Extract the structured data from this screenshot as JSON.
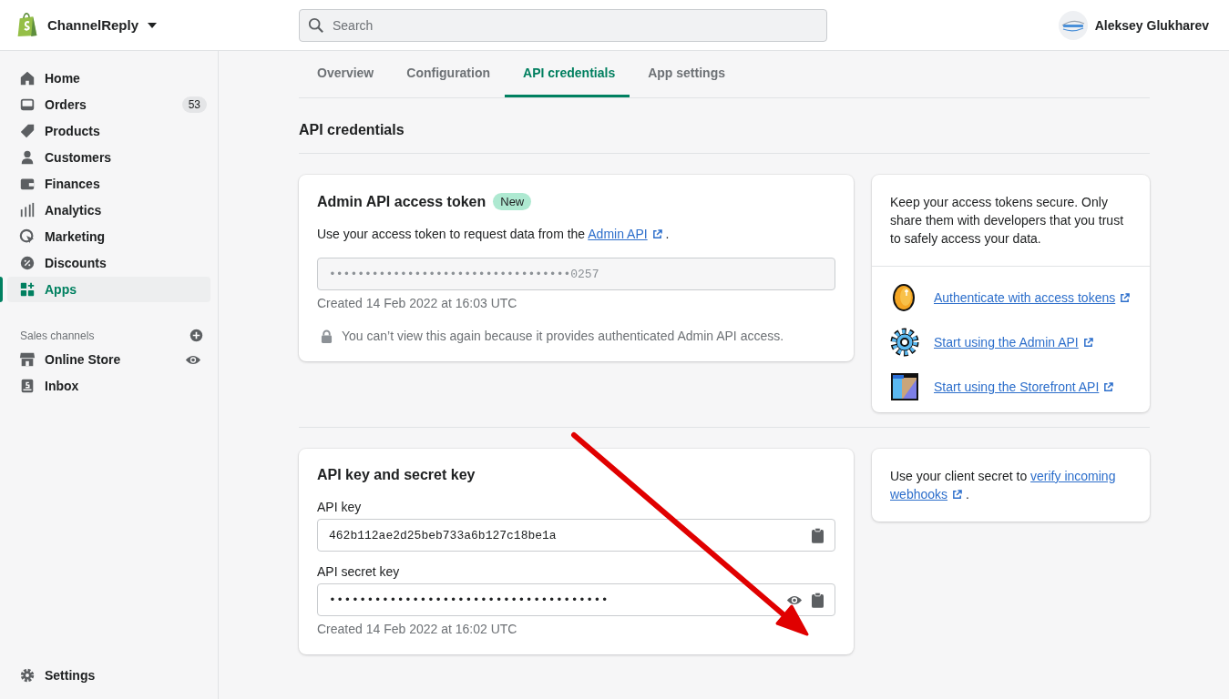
{
  "store": {
    "name": "ChannelReply"
  },
  "search": {
    "placeholder": "Search"
  },
  "user": {
    "name": "Aleksey Glukharev"
  },
  "sidebar": {
    "items": [
      {
        "label": "Home",
        "selected": false
      },
      {
        "label": "Orders",
        "selected": false,
        "badge": "53"
      },
      {
        "label": "Products",
        "selected": false
      },
      {
        "label": "Customers",
        "selected": false
      },
      {
        "label": "Finances",
        "selected": false
      },
      {
        "label": "Analytics",
        "selected": false
      },
      {
        "label": "Marketing",
        "selected": false
      },
      {
        "label": "Discounts",
        "selected": false
      },
      {
        "label": "Apps",
        "selected": true
      }
    ],
    "sales_channels": {
      "title": "Sales channels",
      "items": [
        {
          "label": "Online Store",
          "selected": false
        },
        {
          "label": "Inbox",
          "selected": false
        }
      ]
    },
    "settings": {
      "label": "Settings"
    }
  },
  "tabs": [
    {
      "label": "Overview",
      "selected": false
    },
    {
      "label": "Configuration",
      "selected": false
    },
    {
      "label": "API credentials",
      "selected": true
    },
    {
      "label": "App settings",
      "selected": false
    }
  ],
  "page_title": "API credentials",
  "token_card": {
    "title": "Admin API access token",
    "badge": "New",
    "text_before": "Use your access token to request data from the ",
    "link": "Admin API",
    "text_after": " .",
    "token": "••••••••••••••••••••••••••••••••••0257",
    "created": "Created 14 Feb 2022 at 16:03 UTC",
    "notice": "You can’t view this again because it provides authenticated Admin API access."
  },
  "tips_card": {
    "text": "Keep your access tokens secure. Only share them with developers that you trust to safely access your data.",
    "links": [
      {
        "label": "Authenticate with access tokens"
      },
      {
        "label": "Start using the Admin API"
      },
      {
        "label": "Start using the Storefront API"
      }
    ]
  },
  "keys_card": {
    "title": "API key and secret key",
    "fields": [
      {
        "label": "API key",
        "value": "462b112ae2d25beb733a6b127c18be1a",
        "kind": "plain"
      },
      {
        "label": "API secret key",
        "value": "•••••••••••••••••••••••••••••••••••••",
        "kind": "secret"
      }
    ],
    "created": "Created 14 Feb 2022 at 16:02 UTC"
  },
  "webhook_card": {
    "text_before": "Use your client secret to ",
    "link_lines": [
      "verify incoming",
      "webhooks"
    ],
    "text_after": " ."
  }
}
